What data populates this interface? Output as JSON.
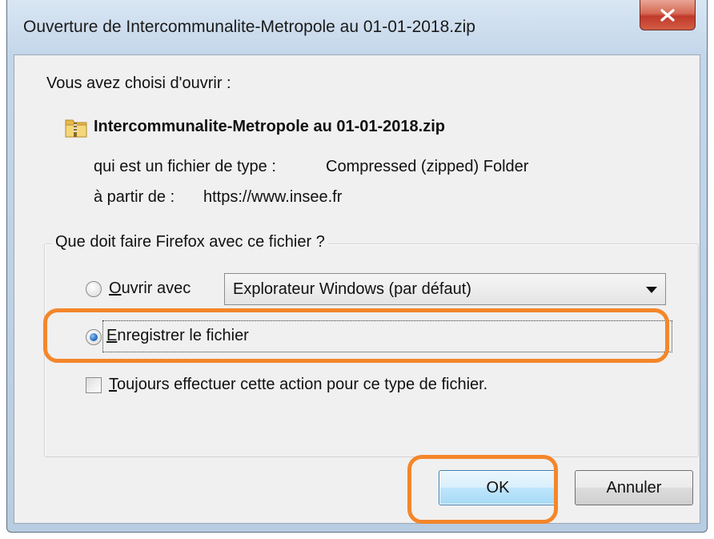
{
  "window": {
    "title": "Ouverture de Intercommunalite-Metropole au 01-01-2018.zip",
    "close_glyph": "x"
  },
  "intro": "Vous avez choisi d'ouvrir :",
  "file": {
    "icon": "zip-folder-icon",
    "name": "Intercommunalite-Metropole au 01-01-2018.zip",
    "type_label": "qui est un fichier de type :",
    "type_value": "Compressed (zipped) Folder",
    "from_label": "à partir de :",
    "from_value": "https://www.insee.fr"
  },
  "group": {
    "legend": "Que doit faire Firefox avec ce fichier ?",
    "open_with": {
      "accesskey": "O",
      "label_rest": "uvrir avec",
      "checked": false,
      "app_selected": "Explorateur Windows (par défaut)"
    },
    "save_file": {
      "accesskey": "E",
      "label_rest": "nregistrer le fichier",
      "checked": true
    },
    "always": {
      "accesskey": "T",
      "label_rest": "oujours effectuer cette action pour ce type de fichier.",
      "checked": false
    }
  },
  "buttons": {
    "ok": "OK",
    "cancel": "Annuler"
  },
  "colors": {
    "highlight": "#f4862a",
    "default_button_border": "#3c7fb1",
    "close_button": "#c0392b"
  }
}
